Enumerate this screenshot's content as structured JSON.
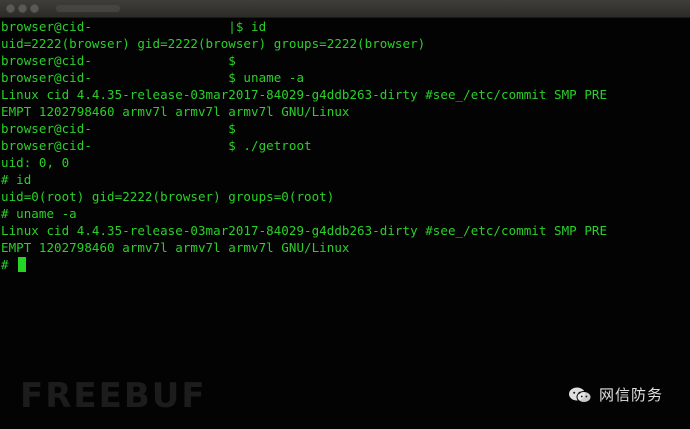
{
  "terminal": {
    "lines": [
      "browser@cid-                  |$ id",
      "uid=2222(browser) gid=2222(browser) groups=2222(browser)",
      "browser@cid-                  $",
      "browser@cid-                  $ uname -a",
      "Linux cid 4.4.35-release-03mar2017-84029-g4ddb263-dirty #see_/etc/commit SMP PRE",
      "EMPT 1202798460 armv7l armv7l armv7l GNU/Linux",
      "browser@cid-                  $",
      "browser@cid-                  $ ./getroot",
      "uid: 0, 0",
      "# id",
      "uid=0(root) gid=2222(browser) groups=0(root)",
      "# uname -a",
      "Linux cid 4.4.35-release-03mar2017-84029-g4ddb263-dirty #see_/etc/commit SMP PRE",
      "EMPT 1202798460 armv7l armv7l armv7l GNU/Linux"
    ],
    "prompt": "# "
  },
  "watermark": {
    "left_text": "FREEBUF",
    "right_text": "网信防务",
    "right_icon": "wechat-icon"
  },
  "colors": {
    "terminal_bg": "#030303",
    "terminal_text": "#2ad02a",
    "cursor": "#25d425"
  }
}
